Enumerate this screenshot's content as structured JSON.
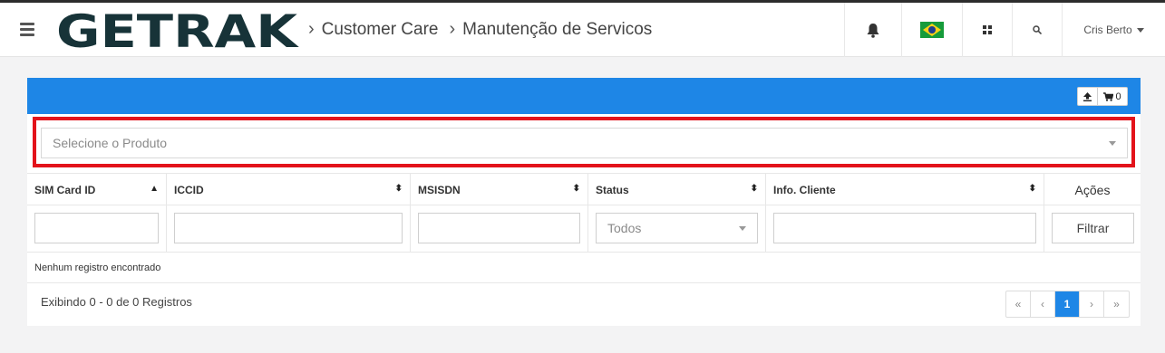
{
  "header": {
    "logo_text": "GETRAK",
    "breadcrumb": [
      "Customer Care",
      "Manutenção de Servicos"
    ],
    "user_name": "Cris Berto",
    "icons": {
      "menu": "hamburger-icon",
      "bell": "bell-icon",
      "flag": "brazil-flag-icon",
      "apps": "apps-grid-icon",
      "search": "search-icon"
    }
  },
  "colors": {
    "accent": "#1e86e6",
    "highlight": "#e3131b",
    "topbar_border": "#2c2c2c"
  },
  "panel": {
    "export_icon": "upload-icon",
    "cart_count": "0",
    "product_placeholder": "Selecione o Produto"
  },
  "table": {
    "columns": [
      "SIM Card ID",
      "ICCID",
      "MSISDN",
      "Status",
      "Info. Cliente",
      "Ações"
    ],
    "status_filter": "Todos",
    "filter_button": "Filtrar",
    "empty_message": "Nenhum registro encontrado"
  },
  "footer": {
    "summary": "Exibindo 0 - 0 de 0 Registros",
    "pagination": {
      "first": "«",
      "prev": "‹",
      "current": "1",
      "next": "›",
      "last": "»"
    }
  }
}
